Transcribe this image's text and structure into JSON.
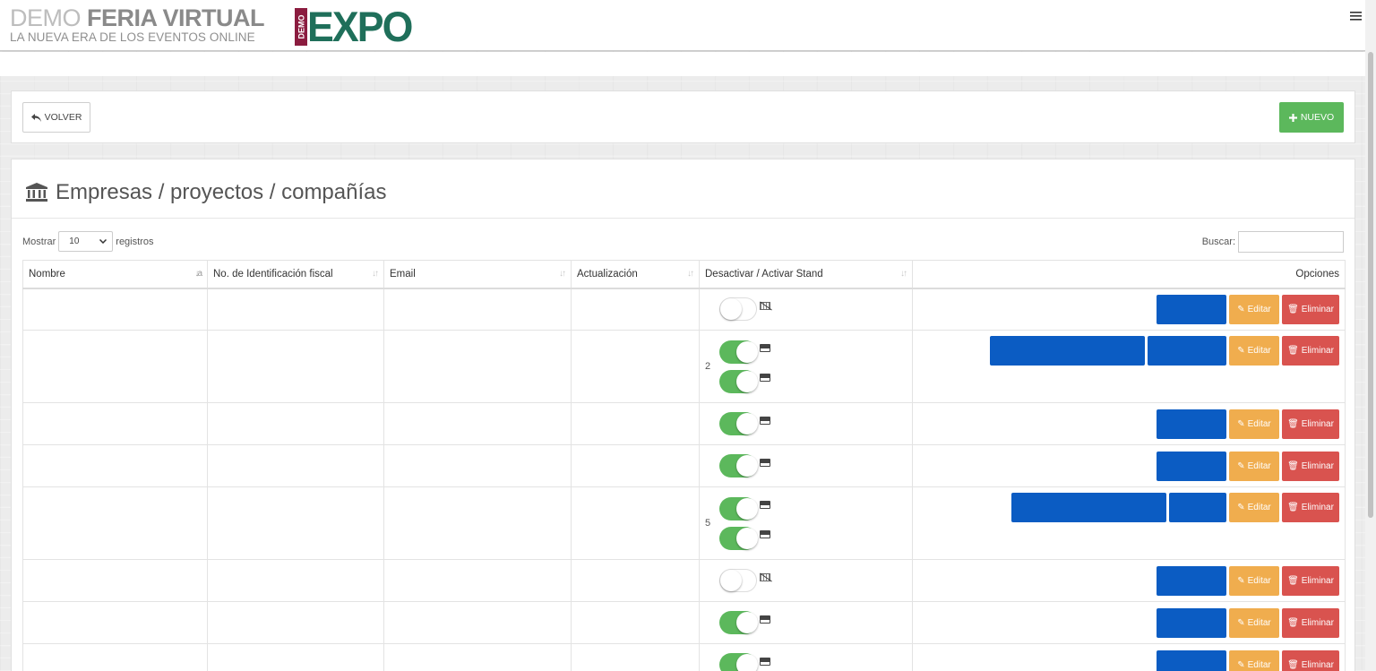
{
  "header": {
    "brand_light": "DEMO",
    "brand_bold": "FERIA VIRTUAL",
    "tagline": "LA NUEVA ERA DE LOS EVENTOS ONLINE",
    "logo_tag": "DEMO",
    "logo_word": "EXPO",
    "menu_icon": "hamburger-icon"
  },
  "toolbar": {
    "back_label": "VOLVER",
    "back_icon": "reply-arrow-icon",
    "new_label": "NUEVO",
    "new_icon": "plus-icon",
    "new_color": "#5cb85c"
  },
  "page": {
    "title": "Empresas / proyectos / compañías",
    "title_icon": "bank-building-icon"
  },
  "table_controls": {
    "show_prefix": "Mostrar",
    "show_value": "10",
    "show_suffix": "registros",
    "search_label": "Buscar:",
    "search_value": ""
  },
  "table": {
    "columns": [
      "Nombre",
      "No. de Identificación fiscal",
      "Email",
      "Actualización",
      "Desactivar / Activar Stand",
      "Opciones"
    ],
    "edit_label": "Editar",
    "delete_label": "Eliminar",
    "colors": {
      "edit": "#f0ad4e",
      "delete": "#d9534f",
      "blue_action": "#0b5cc3",
      "toggle_on": "#5cb85c"
    },
    "rows": [
      {
        "count": "",
        "toggles": [
          false
        ]
      },
      {
        "count": "2",
        "toggles": [
          true,
          true
        ]
      },
      {
        "count": "",
        "toggles": [
          true
        ]
      },
      {
        "count": "",
        "toggles": [
          true
        ]
      },
      {
        "count": "5",
        "toggles": [
          true,
          true
        ]
      },
      {
        "count": "",
        "toggles": [
          false
        ]
      },
      {
        "count": "",
        "toggles": [
          true
        ]
      },
      {
        "count": "",
        "toggles": [
          true
        ]
      }
    ]
  }
}
